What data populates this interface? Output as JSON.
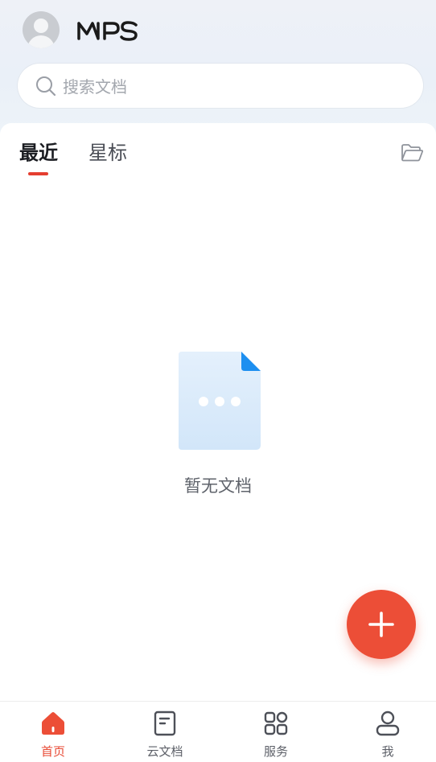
{
  "header": {
    "brand": "WPS",
    "search_placeholder": "搜索文档"
  },
  "tabs": [
    {
      "label": "最近",
      "active": true
    },
    {
      "label": "星标",
      "active": false
    }
  ],
  "empty_state": {
    "message": "暂无文档"
  },
  "bottom_nav": [
    {
      "label": "首页",
      "icon": "home-icon",
      "active": true
    },
    {
      "label": "云文档",
      "icon": "cloud-doc-icon",
      "active": false
    },
    {
      "label": "服务",
      "icon": "services-grid-icon",
      "active": false
    },
    {
      "label": "我",
      "icon": "user-icon",
      "active": false
    }
  ],
  "colors": {
    "accent": "#e84a35",
    "fab": "#ec4e37",
    "header_bg": "#eaf0f8",
    "doc_illustration": "#dcecfb",
    "doc_corner": "#1d8ff0"
  },
  "fab": {
    "icon": "plus-icon"
  }
}
